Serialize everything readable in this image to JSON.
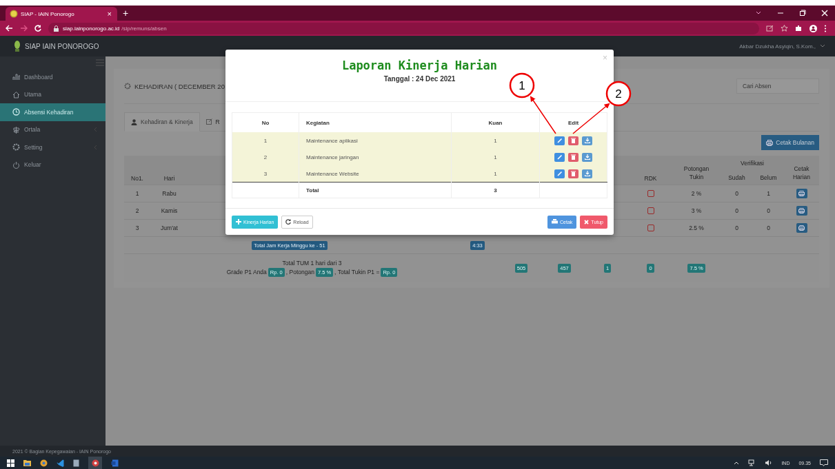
{
  "browser": {
    "tab_title": "SIAP - IAIN Ponorogo",
    "tab_close": "×",
    "new_tab": "+",
    "url_host": "siap.iainponorogo.ac.id",
    "url_path": "/sip/remuns/absen"
  },
  "app_header": {
    "brand": "SIAP IAIN PONOROGO",
    "user": "Akbar Dzukha Asyiqin, S.Kom.,"
  },
  "sidebar": {
    "items": [
      {
        "label": "Dashboard",
        "kind": "dashboard",
        "selected": false,
        "has_submenu": false
      },
      {
        "label": "Utama",
        "kind": "home",
        "selected": false,
        "has_submenu": false
      },
      {
        "label": "Absensi Kehadiran",
        "kind": "clock",
        "selected": true,
        "has_submenu": false
      },
      {
        "label": "Ortala",
        "kind": "sign",
        "selected": false,
        "has_submenu": true
      },
      {
        "label": "Setting",
        "kind": "gear",
        "selected": false,
        "has_submenu": true
      },
      {
        "label": "Keluar",
        "kind": "power",
        "selected": false,
        "has_submenu": false
      }
    ]
  },
  "page": {
    "heading": "KEHADIRAN ( DECEMBER 20",
    "search_placeholder": "Cari Absen",
    "tabs": [
      {
        "label": "Kehadiran & Kinerja",
        "kind": "user",
        "selected": true
      },
      {
        "label": "R",
        "kind": "edit",
        "selected": false
      }
    ],
    "print_month_button": "Cetak Bulanan",
    "table": {
      "headers": {
        "no": "No1.",
        "day": "Hari",
        "rdk": "RDK",
        "cut": "Potongan Tukin",
        "verification": "Verifikasi",
        "done": "Sudah",
        "pending": "Belum",
        "print": "Cetak Harian"
      },
      "rows": [
        {
          "no": "1",
          "day": "Rabu",
          "rdk_checked": false,
          "cut": "2 %",
          "done": "0",
          "pending": "1"
        },
        {
          "no": "2",
          "day": "Kamis",
          "rdk_checked": false,
          "cut": "3 %",
          "done": "0",
          "pending": "0"
        },
        {
          "no": "3",
          "day": "Jum'at",
          "rdk_checked": false,
          "cut": "2.5 %",
          "done": "0",
          "pending": "0"
        }
      ],
      "week_total": {
        "label": "Total Jam Kerja Minggu ke - 51",
        "hours": "4:33"
      },
      "summary": {
        "line": "Total TUM 1 hari dari 3",
        "grade_label": "Grade P1 Anda",
        "grade_value": "Rp. 0",
        "cut_label": ", Potongan",
        "cut_value": "7.5 %",
        "tukin_label": ", Total Tukin P1 =",
        "tukin_value": "Rp. 0",
        "totals": [
          "505",
          "457",
          "1",
          "0",
          "7.5 %"
        ]
      }
    }
  },
  "modal": {
    "title": "Laporan Kinerja Harian",
    "subtitle": "Tanggal : 24 Dec 2021",
    "close": "×",
    "columns": [
      "No",
      "Kegiatan",
      "Kuan",
      "Edit"
    ],
    "rows": [
      {
        "no": "1",
        "activity": "Maintenance aplikasi",
        "qty": "1"
      },
      {
        "no": "2",
        "activity": "Maintenance jaringan",
        "qty": "1"
      },
      {
        "no": "3",
        "activity": "Maintenance Website",
        "qty": "1"
      }
    ],
    "total": {
      "label": "Total",
      "qty": "3"
    },
    "buttons": [
      {
        "label": "Kinerja Harian",
        "kind": "add"
      },
      {
        "label": "Reload",
        "kind": "reload"
      },
      {
        "label": "Cetak",
        "kind": "print"
      },
      {
        "label": "Tutup",
        "kind": "close"
      }
    ]
  },
  "annotations": [
    {
      "number": "1"
    },
    {
      "number": "2"
    }
  ],
  "footer": "2021 © Bagian Kepegawaian - IAIN Ponorogo",
  "taskbar": {
    "language": "IND",
    "time": "09.35"
  }
}
